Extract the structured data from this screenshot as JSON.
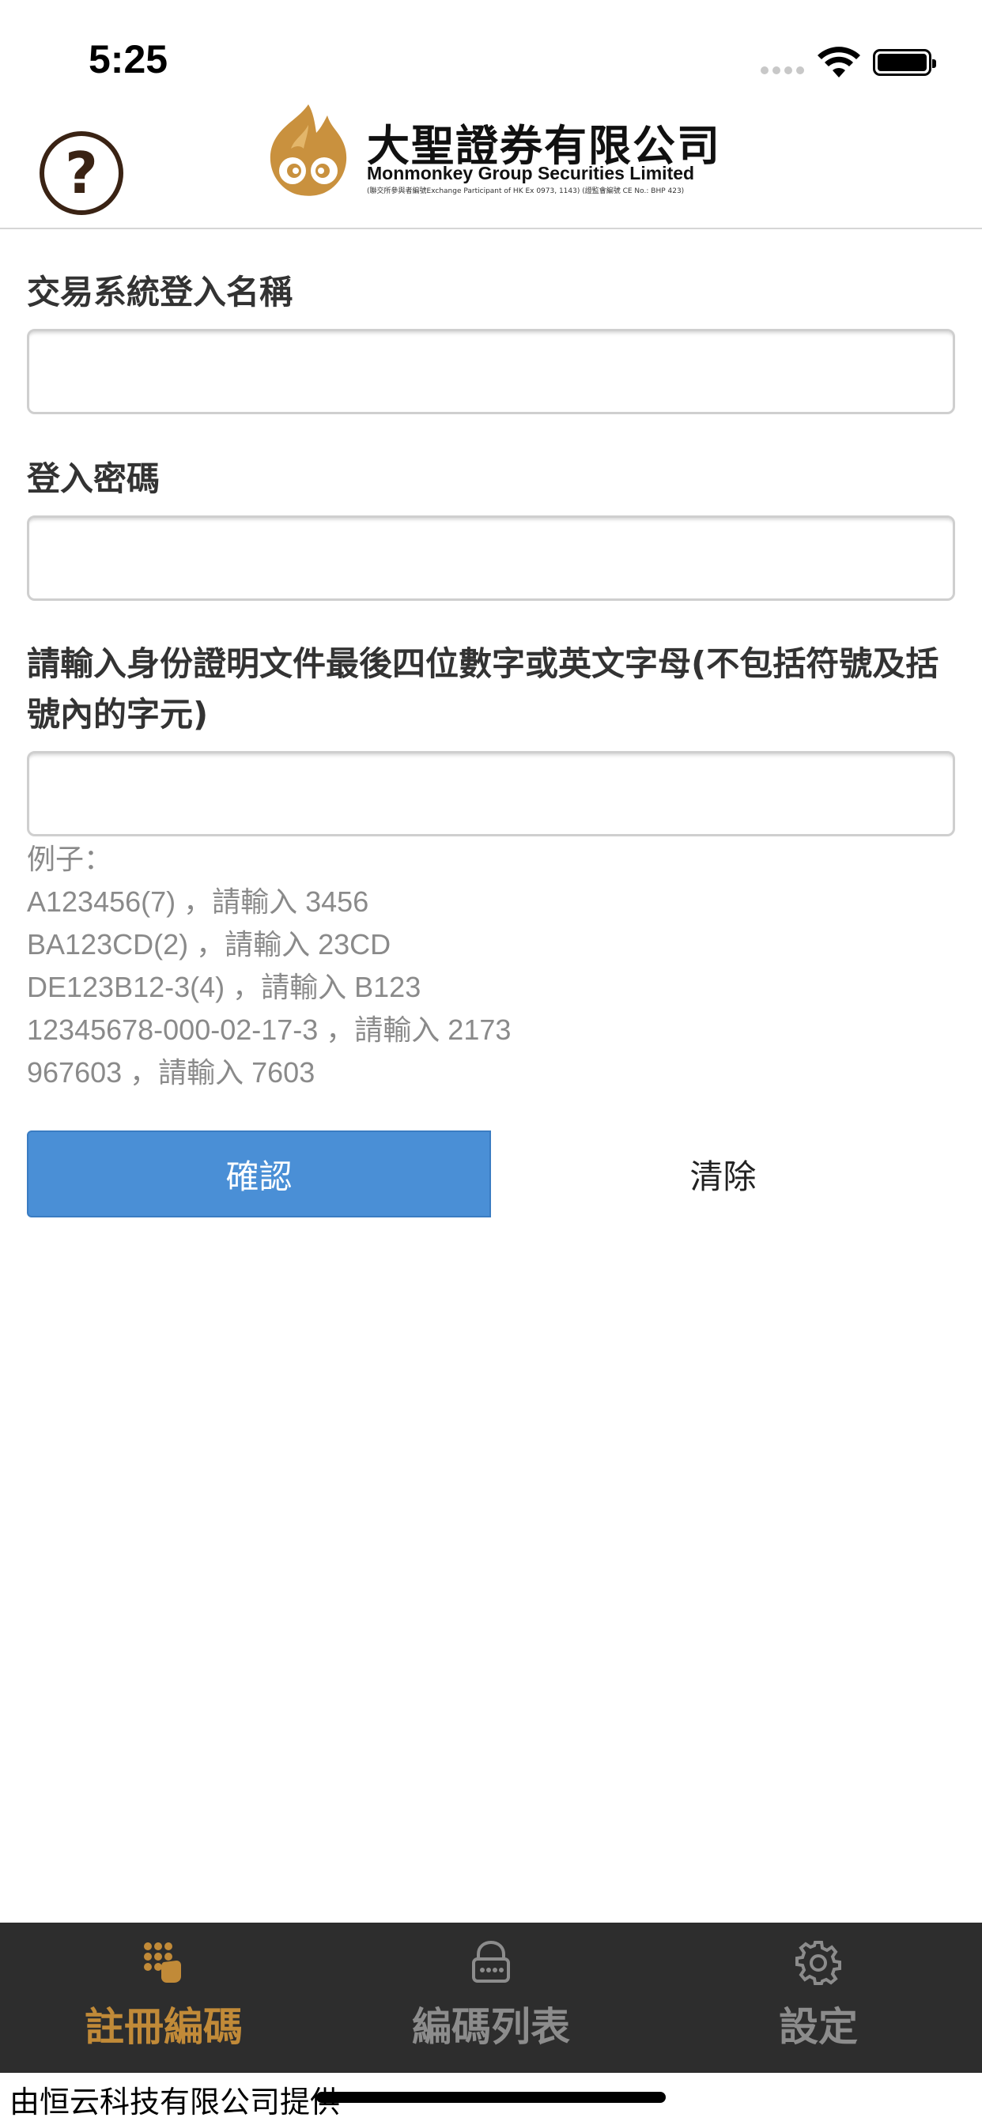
{
  "status_bar": {
    "time": "5:25"
  },
  "header": {
    "help_symbol": "?",
    "logo_cn": "大聖證券有限公司",
    "logo_en": "Monmonkey Group Securities Limited",
    "logo_sub": "(聯交所參與者編號Exchange Participant of HK Ex 0973, 1143) (證監會編號 CE No.: BHP 423)"
  },
  "form": {
    "username_label": "交易系統登入名稱",
    "username_value": "",
    "password_label": "登入密碼",
    "password_value": "",
    "id_label": "請輸入身份證明文件最後四位數字或英文字母(不包括符號及括號內的字元)",
    "id_value": "",
    "examples_title": "例子：",
    "examples": [
      "A123456(7) ，請輸入 3456",
      "BA123CD(2) ，請輸入 23CD",
      "DE123B12-3(4) ，請輸入 B123",
      "12345678-000-02-17-3 ，請輸入 2173",
      "967603 ，請輸入 7603"
    ],
    "confirm_label": "確認",
    "clear_label": "清除"
  },
  "tab_bar": {
    "active_color": "#c18a38",
    "inactive_color": "#8c8c8c",
    "tabs": [
      {
        "label": "註冊編碼",
        "icon": "keypad-hand-icon",
        "active": true
      },
      {
        "label": "編碼列表",
        "icon": "lock-code-icon",
        "active": false
      },
      {
        "label": "設定",
        "icon": "gear-icon",
        "active": false
      }
    ]
  },
  "footer": {
    "text": "由恒云科技有限公司提供"
  },
  "colors": {
    "primary_button": "#4a8fd6",
    "tab_bar_bg": "#2d2d2d"
  }
}
